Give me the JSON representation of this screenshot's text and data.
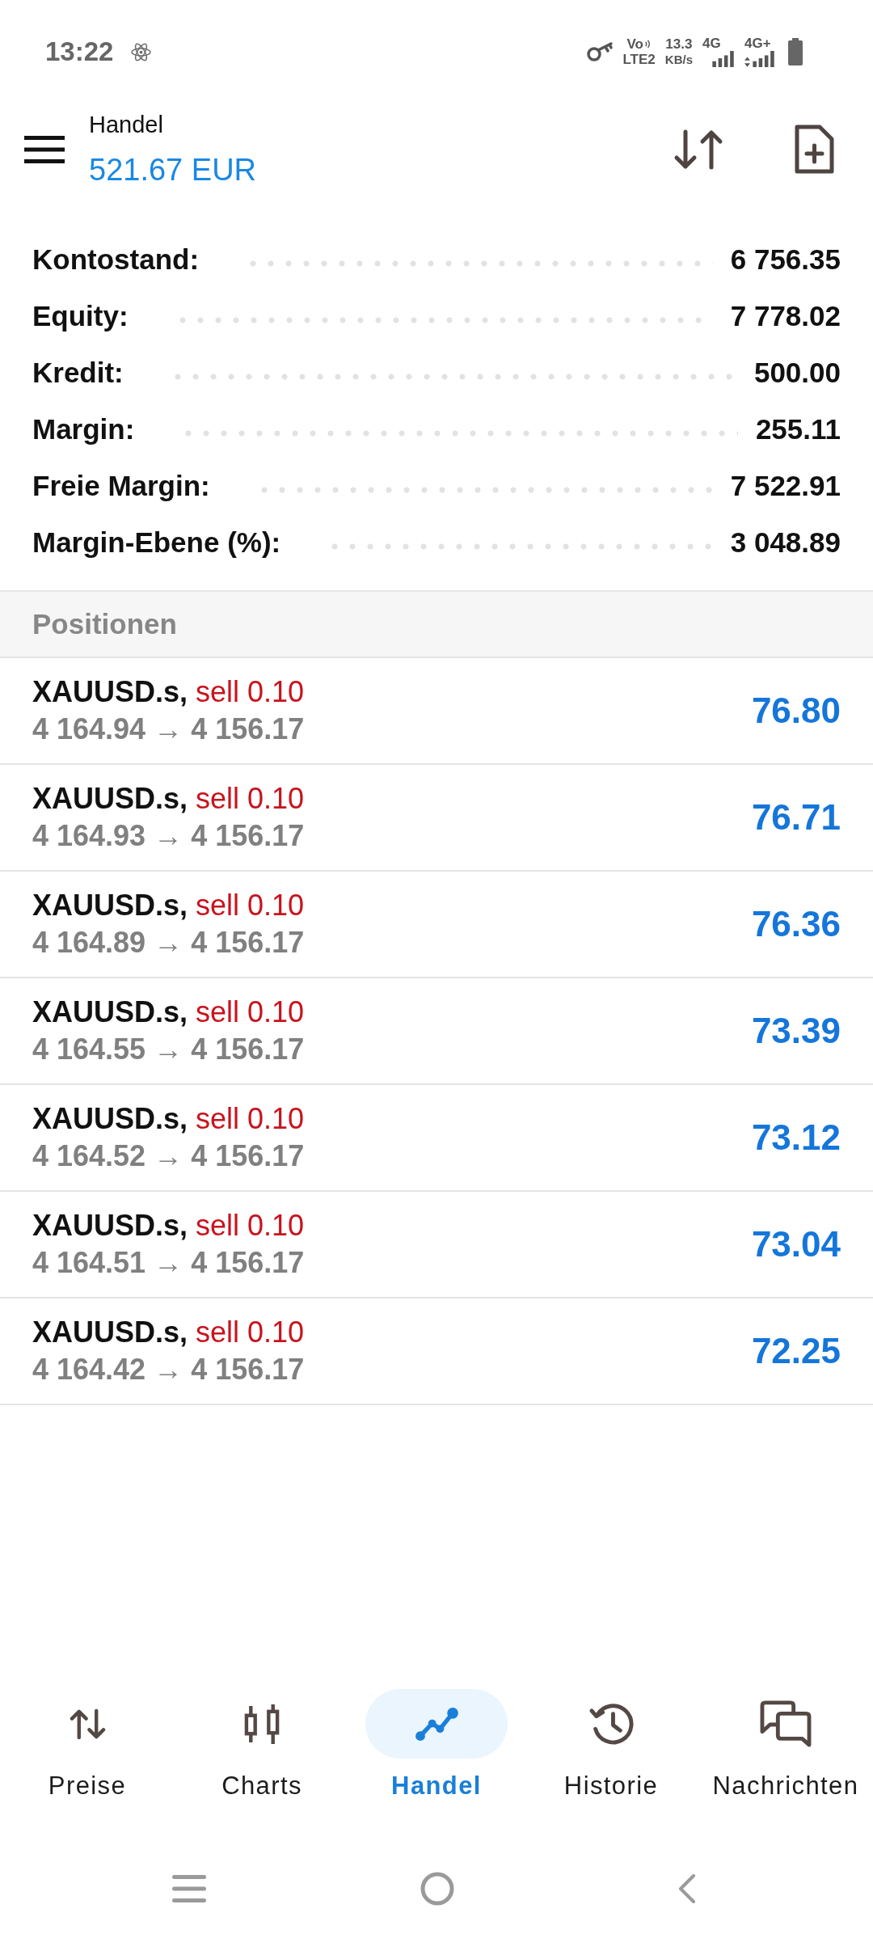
{
  "status_bar": {
    "time": "13:22",
    "volte": "Vo",
    "volte_network": "LTE2",
    "speed": "13.3",
    "speed_unit": "KB/s",
    "sim_1_network": "4G",
    "sim_2_network": "4G+"
  },
  "header": {
    "title": "Handel",
    "balance": "521.67 EUR"
  },
  "account": [
    {
      "label": "Kontostand:",
      "value": "6 756.35"
    },
    {
      "label": "Equity:",
      "value": "7 778.02"
    },
    {
      "label": "Kredit:",
      "value": "500.00"
    },
    {
      "label": "Margin:",
      "value": "255.11"
    },
    {
      "label": "Freie Margin:",
      "value": "7 522.91"
    },
    {
      "label": "Margin-Ebene (%):",
      "value": "3 048.89"
    }
  ],
  "positions": {
    "title": "Positionen",
    "items": [
      {
        "symbol": "XAUUSD.s,",
        "side": "sell 0.10",
        "sell": true,
        "prices": "4 164.94 → 4 156.17",
        "profit": "76.80"
      },
      {
        "symbol": "XAUUSD.s,",
        "side": "sell 0.10",
        "sell": true,
        "prices": "4 164.93 → 4 156.17",
        "profit": "76.71"
      },
      {
        "symbol": "XAUUSD.s,",
        "side": "sell 0.10",
        "sell": true,
        "prices": "4 164.89 → 4 156.17",
        "profit": "76.36"
      },
      {
        "symbol": "XAUUSD.s,",
        "side": "sell 0.10",
        "sell": true,
        "prices": "4 164.55 → 4 156.17",
        "profit": "73.39"
      },
      {
        "symbol": "XAUUSD.s,",
        "side": "sell 0.10",
        "sell": true,
        "prices": "4 164.52 → 4 156.17",
        "profit": "73.12"
      },
      {
        "symbol": "XAUUSD.s,",
        "side": "sell 0.10",
        "sell": true,
        "prices": "4 164.51 → 4 156.17",
        "profit": "73.04"
      },
      {
        "symbol": "XAUUSD.s,",
        "side": "sell 0.10",
        "sell": true,
        "prices": "4 164.42 → 4 156.17",
        "profit": "72.25"
      }
    ]
  },
  "nav": {
    "items": [
      {
        "label": "Preise",
        "kind": "prices",
        "selected": false
      },
      {
        "label": "Charts",
        "kind": "charts",
        "selected": false
      },
      {
        "label": "Handel",
        "kind": "trade",
        "selected": true
      },
      {
        "label": "Historie",
        "kind": "history",
        "selected": false
      },
      {
        "label": "Nachrichten",
        "kind": "messages",
        "selected": false
      }
    ]
  }
}
